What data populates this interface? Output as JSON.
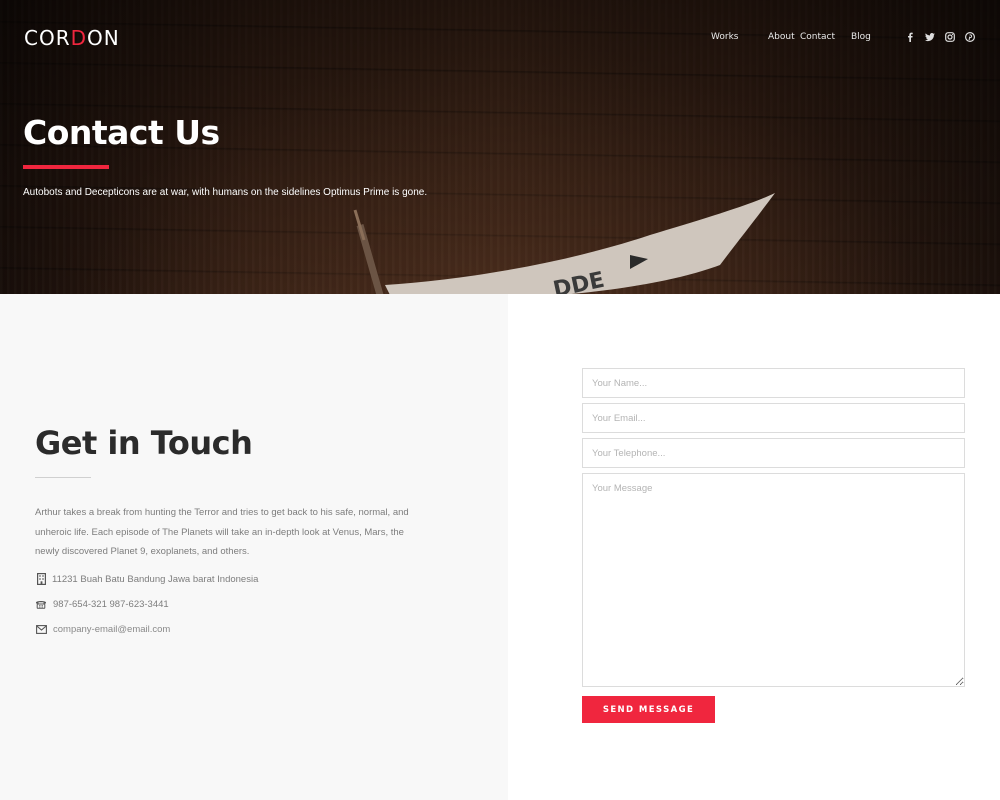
{
  "brand": {
    "logo_pre": "COR",
    "logo_accent": "D",
    "logo_post": "ON",
    "accent_color": "#f0263e"
  },
  "nav": {
    "items": [
      "Works",
      "About",
      "Contact",
      "Blog"
    ]
  },
  "social": [
    "facebook-icon",
    "twitter-icon",
    "instagram-icon",
    "pinterest-icon"
  ],
  "hero": {
    "title": "Contact Us",
    "subtitle": "Autobots and Decepticons are at war, with humans on the sidelines Optimus Prime is gone."
  },
  "contact": {
    "title": "Get in Touch",
    "description": "Arthur takes a break from hunting the Terror and tries to get back to his safe, normal, and unheroic life. Each episode of The Planets will take an in-depth look at Venus, Mars, the newly discovered Planet 9, exoplanets, and others.",
    "address": "11231 Buah Batu Bandung Jawa barat Indonesia",
    "phone": "987-654-321 987-623-3441",
    "email": "company-email@email.com"
  },
  "form": {
    "name_placeholder": "Your Name...",
    "email_placeholder": "Your Email...",
    "telephone_placeholder": "Your Telephone...",
    "message_placeholder": "Your Message",
    "send_label": "SEND MESSAGE"
  }
}
